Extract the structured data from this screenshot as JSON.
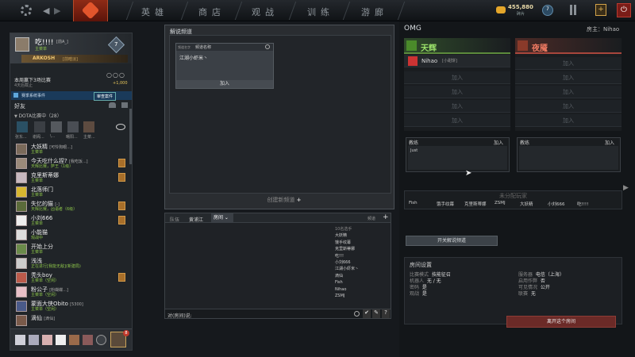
{
  "topbar": {
    "nav": [
      "英雄",
      "商店",
      "观战",
      "训练",
      "游廊"
    ],
    "coins": "455,880",
    "shards": "碎片",
    "badge": "7"
  },
  "profile": {
    "name": "吃!!!!",
    "tag": "[前A_]",
    "status": "主菜单",
    "level": "7",
    "banner": "ARKOSH",
    "banner_sub": "[前暗淡]",
    "weekly": "本周赢下3场比赛",
    "weekly_sub": "4天后截止",
    "reward": "+1,000",
    "event": "赛季系统事件",
    "event_btn": "审查案件"
  },
  "friends": {
    "title": "好友",
    "group": "DOTA比赛中（28）",
    "top_avatars": [
      "张东...",
      "谢阁...",
      "\\...",
      "曙阳...",
      "主菜..."
    ],
    "list": [
      {
        "name": "大妖精",
        "sub": "主菜单",
        "tag": "[可怜狗眼...]"
      },
      {
        "name": "今天吃什么捏?",
        "sub": "天辉比赛，萨王（1级）",
        "tag": "[我吃饭...]",
        "badge": true
      },
      {
        "name": "克里斯蒂娜",
        "sub": "主菜单",
        "badge": true
      },
      {
        "name": "北落师门",
        "sub": "主菜单"
      },
      {
        "name": "失忆的猫",
        "sub": "天辉比赛，凶语者（6级）",
        "tag": "[-]",
        "badge": true
      },
      {
        "name": "小刘666",
        "sub": "主菜单",
        "badge": true
      },
      {
        "name": "小能猫",
        "sub": "观战中"
      },
      {
        "name": "开始上分",
        "sub": "主菜单"
      },
      {
        "name": "浅浅",
        "sub": "正在进行[我能无敌](新建局)"
      },
      {
        "name": "秃头boy",
        "sub": "主菜单（空闲）",
        "badge": true
      },
      {
        "name": "粉公子",
        "sub": "主菜单（空闲）",
        "tag": "[粉蝴蝶...]"
      },
      {
        "name": "蒙面大侠Obito",
        "sub": "主菜单（空闲）",
        "tag": "[5300]"
      },
      {
        "name": "滴仙",
        "sub": "",
        "tag": "[滴仙]"
      }
    ]
  },
  "bottom_badge": "8",
  "mid": {
    "title": "解说频道",
    "col_search": "频道名称",
    "col_left": "频道名字",
    "entry": "江湖小虾米丶",
    "join": "加入",
    "create": "创建新频道"
  },
  "chat": {
    "tabs": [
      "队伍",
      "黄浦江",
      "房间"
    ],
    "add": "频道",
    "prompt": "对(房间)说:",
    "members_title": "10名选手",
    "members": [
      "大妖精",
      "饿手纹幕",
      "克里斯蒂娜",
      "吃!!!",
      "小刘666",
      "江湖小虾米丶",
      "滴仙",
      "Fish",
      "Nihao",
      "ZSMJ"
    ]
  },
  "lobby": {
    "title": "OMG",
    "host_label": "房主：",
    "host": "Nihao",
    "radiant": "天辉",
    "dire": "夜魇",
    "radiant_slots": [
      {
        "name": "Nihao",
        "tag": "[小甜饼]"
      },
      "加入",
      "加入",
      "加入",
      "加入"
    ],
    "dire_slots": [
      "加入",
      "加入",
      "加入",
      "加入",
      "加入"
    ],
    "coach": "教练",
    "coach_join": "加入",
    "coach_name": "Just",
    "unassigned_title": "未分配玩家",
    "unassigned": [
      "Fish",
      "饿手纹幕",
      "克里斯蒂娜",
      "ZSMJ",
      "大妖精",
      "小刘666",
      "吃!!!!"
    ],
    "toggle_btn": "开关解说频道",
    "settings_title": "房间设置",
    "settings_left": [
      [
        "比赛模式",
        "技能征召"
      ],
      [
        "机器人",
        "无 / 无"
      ],
      [
        "密码",
        "是"
      ],
      [
        "观战",
        "是"
      ]
    ],
    "settings_right": [
      [
        "服务器",
        "电信（上海）"
      ],
      [
        "启用作弊",
        "否"
      ],
      [
        "可见情况",
        "公开"
      ],
      [
        "联赛",
        "无"
      ]
    ],
    "leave": "离开这个房间"
  }
}
